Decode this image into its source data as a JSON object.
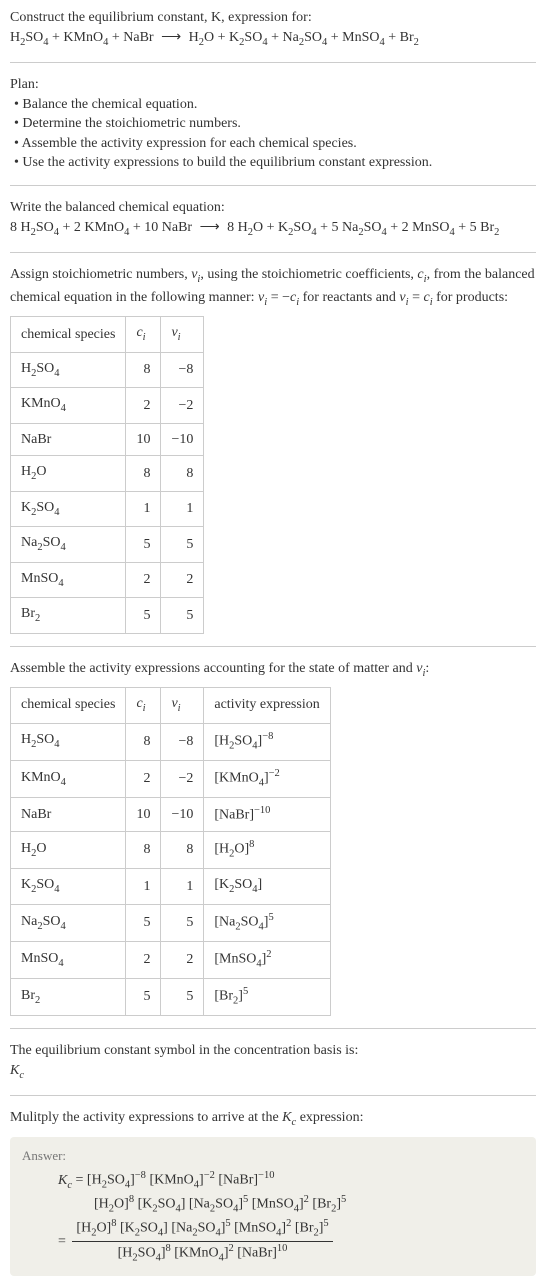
{
  "intro": {
    "line1": "Construct the equilibrium constant, K, expression for:",
    "equation_unbalanced_html": "H<sub>2</sub>SO<sub>4</sub> + KMnO<sub>4</sub> + NaBr <span class='arrow'>⟶</span> H<sub>2</sub>O + K<sub>2</sub>SO<sub>4</sub> + Na<sub>2</sub>SO<sub>4</sub> + MnSO<sub>4</sub> + Br<sub>2</sub>"
  },
  "plan": {
    "heading": "Plan:",
    "items": [
      "Balance the chemical equation.",
      "Determine the stoichiometric numbers.",
      "Assemble the activity expression for each chemical species.",
      "Use the activity expressions to build the equilibrium constant expression."
    ]
  },
  "balanced": {
    "heading": "Write the balanced chemical equation:",
    "equation_html": "8 H<sub>2</sub>SO<sub>4</sub> + 2 KMnO<sub>4</sub> + 10 NaBr <span class='arrow'>⟶</span> 8 H<sub>2</sub>O + K<sub>2</sub>SO<sub>4</sub> + 5 Na<sub>2</sub>SO<sub>4</sub> + 2 MnSO<sub>4</sub> + 5 Br<sub>2</sub>"
  },
  "stoich": {
    "text_html": "Assign stoichiometric numbers, <span class='italic'>ν<sub>i</sub></span>, using the stoichiometric coefficients, <span class='italic'>c<sub>i</sub></span>, from the balanced chemical equation in the following manner: <span class='italic'>ν<sub>i</sub></span> = −<span class='italic'>c<sub>i</sub></span> for reactants and <span class='italic'>ν<sub>i</sub></span> = <span class='italic'>c<sub>i</sub></span> for products:",
    "headers": [
      "chemical species",
      "c_i",
      "v_i"
    ],
    "headers_html": [
      "chemical species",
      "<span class='italic'>c<sub>i</sub></span>",
      "<span class='italic'>ν<sub>i</sub></span>"
    ],
    "rows": [
      {
        "species_html": "H<sub>2</sub>SO<sub>4</sub>",
        "c": "8",
        "v": "−8"
      },
      {
        "species_html": "KMnO<sub>4</sub>",
        "c": "2",
        "v": "−2"
      },
      {
        "species_html": "NaBr",
        "c": "10",
        "v": "−10"
      },
      {
        "species_html": "H<sub>2</sub>O",
        "c": "8",
        "v": "8"
      },
      {
        "species_html": "K<sub>2</sub>SO<sub>4</sub>",
        "c": "1",
        "v": "1"
      },
      {
        "species_html": "Na<sub>2</sub>SO<sub>4</sub>",
        "c": "5",
        "v": "5"
      },
      {
        "species_html": "MnSO<sub>4</sub>",
        "c": "2",
        "v": "2"
      },
      {
        "species_html": "Br<sub>2</sub>",
        "c": "5",
        "v": "5"
      }
    ]
  },
  "activity": {
    "text_html": "Assemble the activity expressions accounting for the state of matter and <span class='italic'>ν<sub>i</sub></span>:",
    "headers_html": [
      "chemical species",
      "<span class='italic'>c<sub>i</sub></span>",
      "<span class='italic'>ν<sub>i</sub></span>",
      "activity expression"
    ],
    "rows": [
      {
        "species_html": "H<sub>2</sub>SO<sub>4</sub>",
        "c": "8",
        "v": "−8",
        "act_html": "[H<sub>2</sub>SO<sub>4</sub>]<sup>−8</sup>"
      },
      {
        "species_html": "KMnO<sub>4</sub>",
        "c": "2",
        "v": "−2",
        "act_html": "[KMnO<sub>4</sub>]<sup>−2</sup>"
      },
      {
        "species_html": "NaBr",
        "c": "10",
        "v": "−10",
        "act_html": "[NaBr]<sup>−10</sup>"
      },
      {
        "species_html": "H<sub>2</sub>O",
        "c": "8",
        "v": "8",
        "act_html": "[H<sub>2</sub>O]<sup>8</sup>"
      },
      {
        "species_html": "K<sub>2</sub>SO<sub>4</sub>",
        "c": "1",
        "v": "1",
        "act_html": "[K<sub>2</sub>SO<sub>4</sub>]"
      },
      {
        "species_html": "Na<sub>2</sub>SO<sub>4</sub>",
        "c": "5",
        "v": "5",
        "act_html": "[Na<sub>2</sub>SO<sub>4</sub>]<sup>5</sup>"
      },
      {
        "species_html": "MnSO<sub>4</sub>",
        "c": "2",
        "v": "2",
        "act_html": "[MnSO<sub>4</sub>]<sup>2</sup>"
      },
      {
        "species_html": "Br<sub>2</sub>",
        "c": "5",
        "v": "5",
        "act_html": "[Br<sub>2</sub>]<sup>5</sup>"
      }
    ]
  },
  "symbol": {
    "text": "The equilibrium constant symbol in the concentration basis is:",
    "symbol_html": "<span class='italic'>K<sub>c</sub></span>"
  },
  "multiply": {
    "text_html": "Mulitply the activity expressions to arrive at the <span class='italic'>K<sub>c</sub></span> expression:"
  },
  "answer": {
    "label": "Answer:",
    "line1_html": "<span class='italic'>K<sub>c</sub></span> = [H<sub>2</sub>SO<sub>4</sub>]<sup>−8</sup> [KMnO<sub>4</sub>]<sup>−2</sup> [NaBr]<sup>−10</sup>",
    "line2_html": "[H<sub>2</sub>O]<sup>8</sup> [K<sub>2</sub>SO<sub>4</sub>] [Na<sub>2</sub>SO<sub>4</sub>]<sup>5</sup> [MnSO<sub>4</sub>]<sup>2</sup> [Br<sub>2</sub>]<sup>5</sup>",
    "frac_num_html": "[H<sub>2</sub>O]<sup>8</sup> [K<sub>2</sub>SO<sub>4</sub>] [Na<sub>2</sub>SO<sub>4</sub>]<sup>5</sup> [MnSO<sub>4</sub>]<sup>2</sup> [Br<sub>2</sub>]<sup>5</sup>",
    "frac_den_html": "[H<sub>2</sub>SO<sub>4</sub>]<sup>8</sup> [KMnO<sub>4</sub>]<sup>2</sup> [NaBr]<sup>10</sup>"
  },
  "chart_data": {
    "type": "table",
    "tables": [
      {
        "title": "Stoichiometric numbers",
        "columns": [
          "chemical species",
          "c_i",
          "v_i"
        ],
        "rows": [
          [
            "H2SO4",
            8,
            -8
          ],
          [
            "KMnO4",
            2,
            -2
          ],
          [
            "NaBr",
            10,
            -10
          ],
          [
            "H2O",
            8,
            8
          ],
          [
            "K2SO4",
            1,
            1
          ],
          [
            "Na2SO4",
            5,
            5
          ],
          [
            "MnSO4",
            2,
            2
          ],
          [
            "Br2",
            5,
            5
          ]
        ]
      },
      {
        "title": "Activity expressions",
        "columns": [
          "chemical species",
          "c_i",
          "v_i",
          "activity expression"
        ],
        "rows": [
          [
            "H2SO4",
            8,
            -8,
            "[H2SO4]^-8"
          ],
          [
            "KMnO4",
            2,
            -2,
            "[KMnO4]^-2"
          ],
          [
            "NaBr",
            10,
            -10,
            "[NaBr]^-10"
          ],
          [
            "H2O",
            8,
            8,
            "[H2O]^8"
          ],
          [
            "K2SO4",
            1,
            1,
            "[K2SO4]"
          ],
          [
            "Na2SO4",
            5,
            5,
            "[Na2SO4]^5"
          ],
          [
            "MnSO4",
            2,
            2,
            "[MnSO4]^2"
          ],
          [
            "Br2",
            5,
            5,
            "[Br2]^5"
          ]
        ]
      }
    ]
  }
}
